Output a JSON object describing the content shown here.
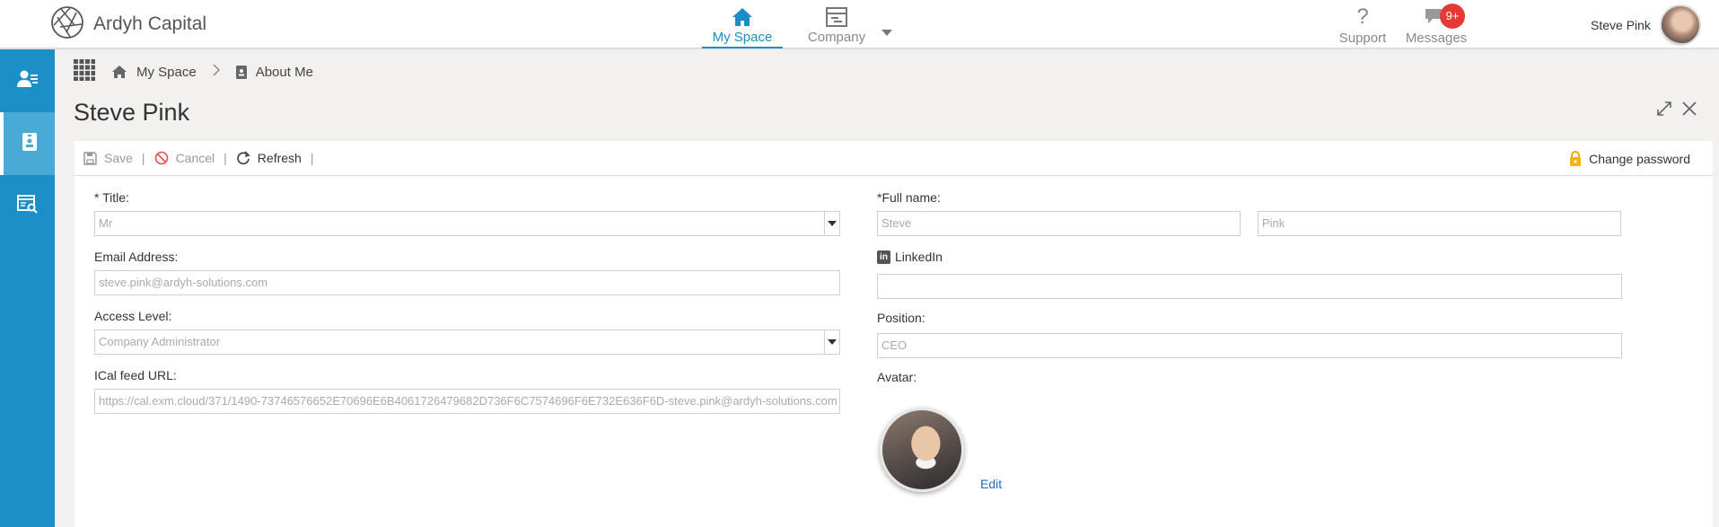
{
  "app": {
    "name": "Ardyh Capital"
  },
  "nav": {
    "items": [
      {
        "label": "My Space",
        "icon": "home-icon",
        "active": true
      },
      {
        "label": "Company",
        "icon": "company-icon",
        "active": false
      }
    ],
    "support_label": "Support",
    "messages_label": "Messages",
    "messages_badge": "9+"
  },
  "user": {
    "name": "Steve Pink"
  },
  "sidebar": {
    "items": [
      "contact-list-icon",
      "id-badge-icon",
      "report-search-icon"
    ],
    "active_index": 1
  },
  "breadcrumb": {
    "items": [
      "My Space",
      "About Me"
    ]
  },
  "page": {
    "title": "Steve Pink"
  },
  "toolbar": {
    "save_label": "Save",
    "cancel_label": "Cancel",
    "refresh_label": "Refresh",
    "change_password_label": "Change password"
  },
  "form": {
    "title_label": "* Title:",
    "title_value": "Mr",
    "email_label": "Email Address:",
    "email_value": "steve.pink@ardyh-solutions.com",
    "access_label": "Access Level:",
    "access_value": "Company Administrator",
    "ical_label": "ICal feed URL:",
    "ical_value": "https://cal.exm.cloud/371/1490-73746576652E70696E6B4061726479682D736F6C7574696F6E732E636F6D-steve.pink@ardyh-solutions.com",
    "fullname_label": "*Full name:",
    "first_name": "Steve",
    "last_name": "Pink",
    "linkedin_label": "LinkedIn",
    "linkedin_value": "",
    "position_label": "Position:",
    "position_value": "CEO",
    "avatar_label": "Avatar:",
    "edit_label": "Edit"
  },
  "colors": {
    "accent": "#1b8cc7",
    "sidebar": "#1c8fc7",
    "badge": "#e53935",
    "link": "#1b6fbd"
  }
}
